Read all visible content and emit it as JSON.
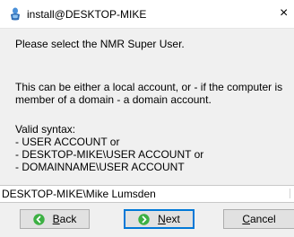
{
  "window": {
    "title": "install@DESKTOP-MIKE",
    "close_glyph": "×",
    "icon": "app-installer-icon"
  },
  "content": {
    "prompt": "Please select the NMR Super User.",
    "description_line1": "This can be either a local account, or  - if the computer is",
    "description_line2": "member of a domain -  a domain account.",
    "valid_syntax_label": "Valid syntax:",
    "syntax_lines": [
      "- USER ACCOUNT  or",
      "- DESKTOP-MIKE\\USER ACCOUNT  or",
      "- DOMAINNAME\\USER ACCOUNT"
    ]
  },
  "user_field": {
    "value": "DESKTOP-MIKE\\Mike Lumsden"
  },
  "buttons": {
    "back": {
      "mnemonic": "B",
      "rest": "ack",
      "icon": "green-left-arrow-icon"
    },
    "next": {
      "mnemonic": "N",
      "rest": "ext",
      "icon": "green-right-arrow-icon"
    },
    "cancel": {
      "mnemonic": "C",
      "rest": "ancel"
    }
  },
  "colors": {
    "accent": "#0078d7",
    "arrow_green": "#3cb043",
    "window_bg": "#f0f0f0"
  }
}
